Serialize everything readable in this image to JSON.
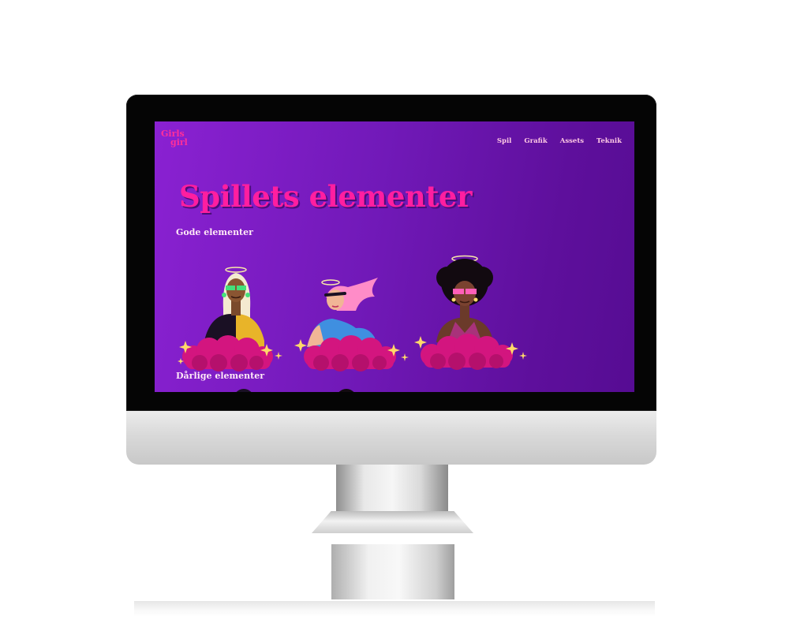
{
  "logo": {
    "line1": "Girls",
    "line2": "girl"
  },
  "nav": [
    {
      "label": "Spil"
    },
    {
      "label": "Grafik"
    },
    {
      "label": "Assets"
    },
    {
      "label": "Teknik"
    }
  ],
  "page": {
    "title": "Spillets elementer",
    "good_heading": "Gode elementer",
    "bad_heading": "Dårlige elementer"
  },
  "characters": [
    {
      "icon": "blonde-girl-green-glasses-icon"
    },
    {
      "icon": "pink-hair-girl-blue-dress-icon"
    },
    {
      "icon": "afro-girl-pink-glasses-icon"
    }
  ],
  "colors": {
    "accent_pink": "#ff1ea0",
    "nav_text": "#ffc8e4",
    "background_purple": "#7119b8",
    "cloud_magenta": "#d3157f",
    "sparkle_gold": "#ffd96a"
  }
}
